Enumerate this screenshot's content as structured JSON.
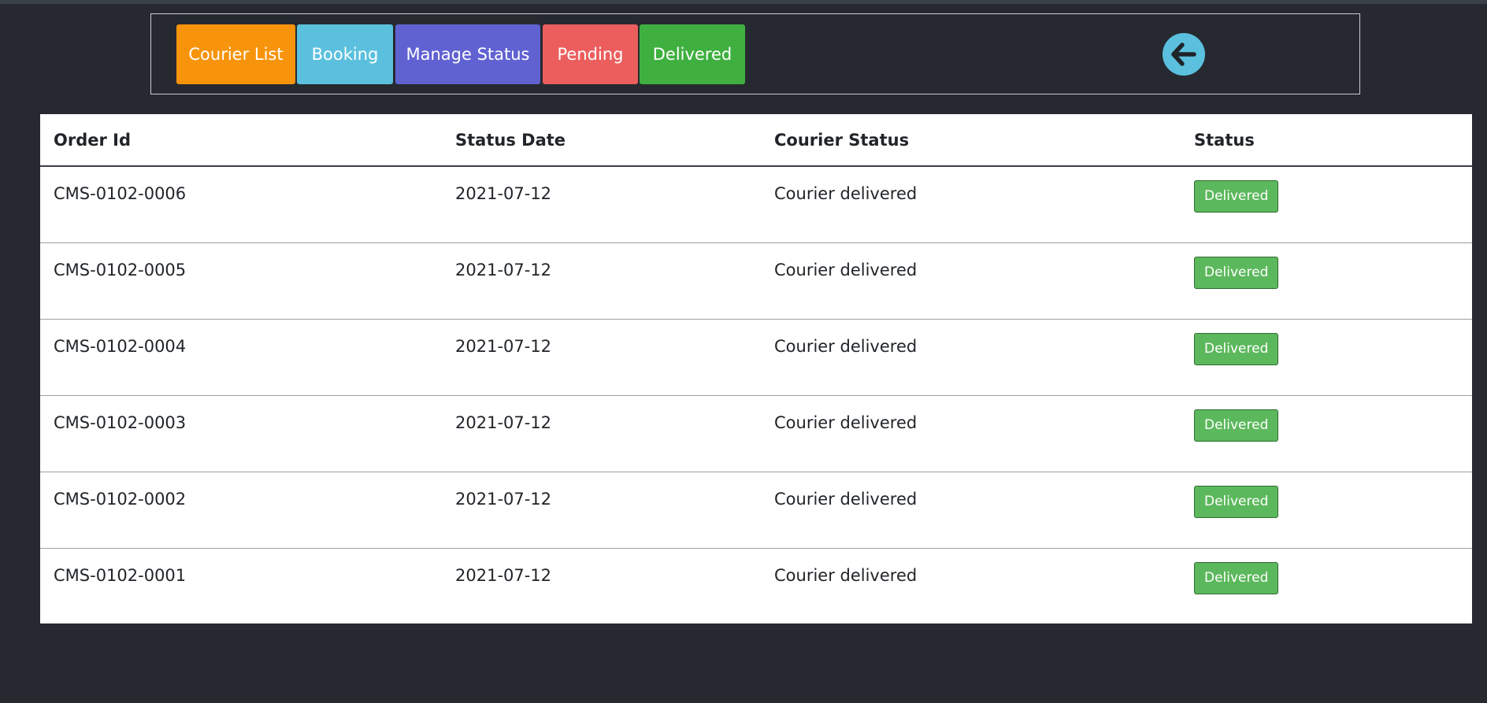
{
  "nav": {
    "buttons": [
      {
        "label": "Courier List",
        "color": "#f7940b"
      },
      {
        "label": "Booking",
        "color": "#5bc0de"
      },
      {
        "label": "Manage Status",
        "color": "#6162d2"
      },
      {
        "label": "Pending",
        "color": "#ec5e5e"
      },
      {
        "label": "Delivered",
        "color": "#3fb03f"
      }
    ],
    "back_icon": "arrow-left-circle-icon"
  },
  "table": {
    "headers": [
      "Order Id",
      "Status Date",
      "Courier Status",
      "Status"
    ],
    "rows": [
      {
        "order_id": "CMS-0102-0006",
        "status_date": "2021-07-12",
        "courier_status": "Courier delivered",
        "status": "Delivered"
      },
      {
        "order_id": "CMS-0102-0005",
        "status_date": "2021-07-12",
        "courier_status": "Courier delivered",
        "status": "Delivered"
      },
      {
        "order_id": "CMS-0102-0004",
        "status_date": "2021-07-12",
        "courier_status": "Courier delivered",
        "status": "Delivered"
      },
      {
        "order_id": "CMS-0102-0003",
        "status_date": "2021-07-12",
        "courier_status": "Courier delivered",
        "status": "Delivered"
      },
      {
        "order_id": "CMS-0102-0002",
        "status_date": "2021-07-12",
        "courier_status": "Courier delivered",
        "status": "Delivered"
      },
      {
        "order_id": "CMS-0102-0001",
        "status_date": "2021-07-12",
        "courier_status": "Courier delivered",
        "status": "Delivered"
      }
    ]
  },
  "colors": {
    "background": "#262a30",
    "badge_success": "#5cb85c"
  }
}
